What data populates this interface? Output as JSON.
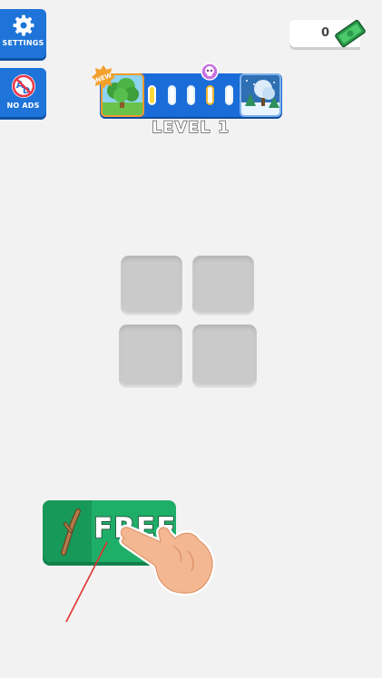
{
  "hud": {
    "settings_label": "SETTINGS",
    "no_ads_label": "NO ADS",
    "cash_value": "0"
  },
  "level_progress": {
    "new_badge": "NEW",
    "level_label": "LEVEL 1",
    "pills": [
      "done",
      "empty",
      "empty",
      "boss",
      "empty"
    ]
  },
  "board": {
    "tiles": [
      "empty",
      "empty",
      "empty",
      "empty"
    ]
  },
  "action": {
    "free_label": "FREE"
  },
  "colors": {
    "accent_blue": "#1e74d8",
    "free_green": "#1eae68",
    "background": "#f2f2f2",
    "tile_grey": "#cacaca"
  },
  "icons": [
    "gear-icon",
    "no-ads-icon",
    "cash-icon",
    "forest-thumbnail",
    "winter-thumbnail",
    "skull-icon",
    "stick-icon",
    "tap-hand-icon"
  ]
}
